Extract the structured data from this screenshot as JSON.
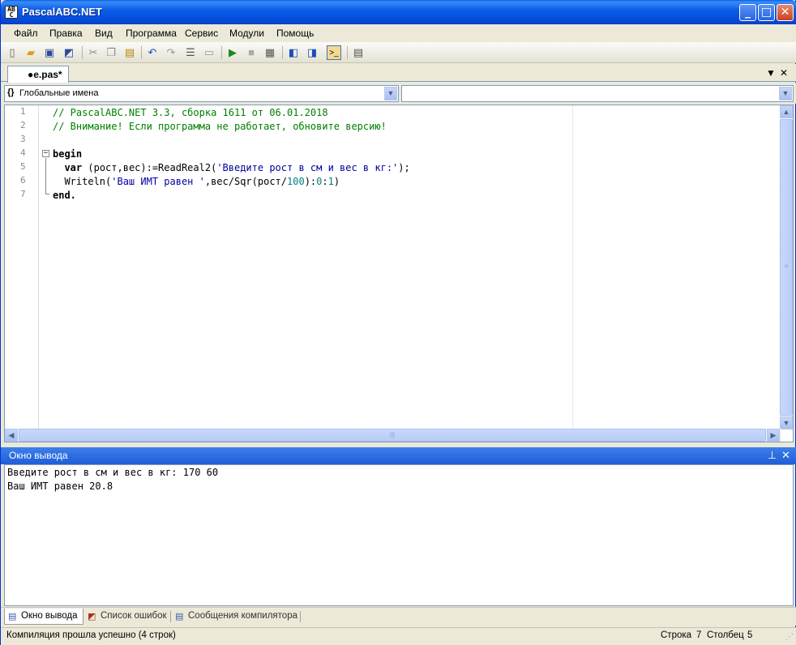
{
  "window": {
    "title": "PascalABC.NET"
  },
  "menu": [
    "Файл",
    "Правка",
    "Вид",
    "Программа",
    "Сервис",
    "Модули",
    "Помощь"
  ],
  "document_tab": {
    "label": "●e.pas*"
  },
  "combos": {
    "left_value": "Глобальные имена",
    "right_value": ""
  },
  "editor": {
    "line_numbers": [
      "1",
      "2",
      "3",
      "4",
      "5",
      "6",
      "7"
    ],
    "lines": [
      {
        "parts": [
          {
            "t": "// PascalABC.NET 3.3, сборка 1611 от 06.01.2018",
            "c": "cmt"
          }
        ]
      },
      {
        "parts": [
          {
            "t": "// Внимание! Если программа не работает, обновите версию!",
            "c": "cmt"
          }
        ]
      },
      {
        "parts": []
      },
      {
        "parts": [
          {
            "t": "begin",
            "c": "kw"
          }
        ]
      },
      {
        "parts": [
          {
            "t": "  ",
            "c": ""
          },
          {
            "t": "var",
            "c": "kw"
          },
          {
            "t": " (рост,вес):=ReadReal2(",
            "c": ""
          },
          {
            "t": "'Введите рост в см и вес в кг:'",
            "c": "str"
          },
          {
            "t": ");",
            "c": ""
          }
        ]
      },
      {
        "parts": [
          {
            "t": "  Writeln(",
            "c": ""
          },
          {
            "t": "'Ваш ИМТ равен '",
            "c": "str"
          },
          {
            "t": ",вес/Sqr(рост/",
            "c": ""
          },
          {
            "t": "100",
            "c": "num"
          },
          {
            "t": "):",
            "c": ""
          },
          {
            "t": "0",
            "c": "num"
          },
          {
            "t": ":",
            "c": ""
          },
          {
            "t": "1",
            "c": "num"
          },
          {
            "t": ")",
            "c": ""
          }
        ]
      },
      {
        "parts": [
          {
            "t": "end.",
            "c": "kw"
          }
        ]
      }
    ]
  },
  "output_panel": {
    "title": "Окно вывода",
    "lines": [
      "Введите рост в см и вес в кг: 170 60",
      "Ваш ИМТ равен 20.8"
    ]
  },
  "bottom_tabs": [
    "Окно вывода",
    "Список ошибок",
    "Сообщения компилятора"
  ],
  "status": {
    "message": "Компиляция прошла успешно (4 строк)",
    "row_label": "Строка",
    "row_value": "7",
    "col_label": "Столбец",
    "col_value": "5"
  },
  "icons": [
    "new-file-icon",
    "open-icon",
    "save-icon",
    "save-all-icon",
    "cut-icon",
    "copy-icon",
    "paste-icon",
    "undo-icon",
    "redo-icon",
    "format-icon",
    "debug-icon",
    "run-icon",
    "stop-icon",
    "form-designer-icon",
    "comment-icon",
    "uncomment-icon",
    "output-window-icon",
    "properties-icon"
  ]
}
